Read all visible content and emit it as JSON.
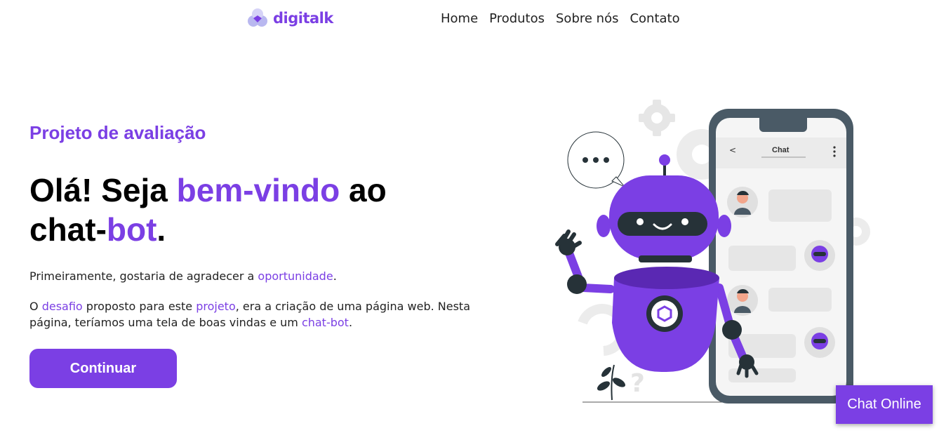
{
  "header": {
    "logo_text": "digitalk",
    "nav": [
      {
        "label": "Home"
      },
      {
        "label": "Produtos"
      },
      {
        "label": "Sobre nós"
      },
      {
        "label": "Contato"
      }
    ]
  },
  "hero": {
    "subtitle": "Projeto de avaliação",
    "title": {
      "part1": "Olá! Seja ",
      "accent1": "bem-vindo",
      "part2": " ao chat-",
      "accent2": "bot",
      "part3": "."
    },
    "paragraph1": {
      "text1": "Primeiramente, gostaria de agradecer a ",
      "link1": "oportunidade",
      "text2": "."
    },
    "paragraph2": {
      "text1": "O ",
      "link1": "desafio",
      "text2": " proposto para este ",
      "link2": "projeto",
      "text3": ", era a criação de uma página web. Nesta página, teríamos uma tela de boas vindas e um ",
      "link3": "chat-bot",
      "text4": "."
    },
    "cta_label": "Continuar"
  },
  "illustration": {
    "phone_header": "Chat"
  },
  "chat_widget": {
    "label": "Chat Online"
  },
  "colors": {
    "accent": "#7b3fe4",
    "text": "#000000",
    "phone_frame": "#4a5a66"
  }
}
